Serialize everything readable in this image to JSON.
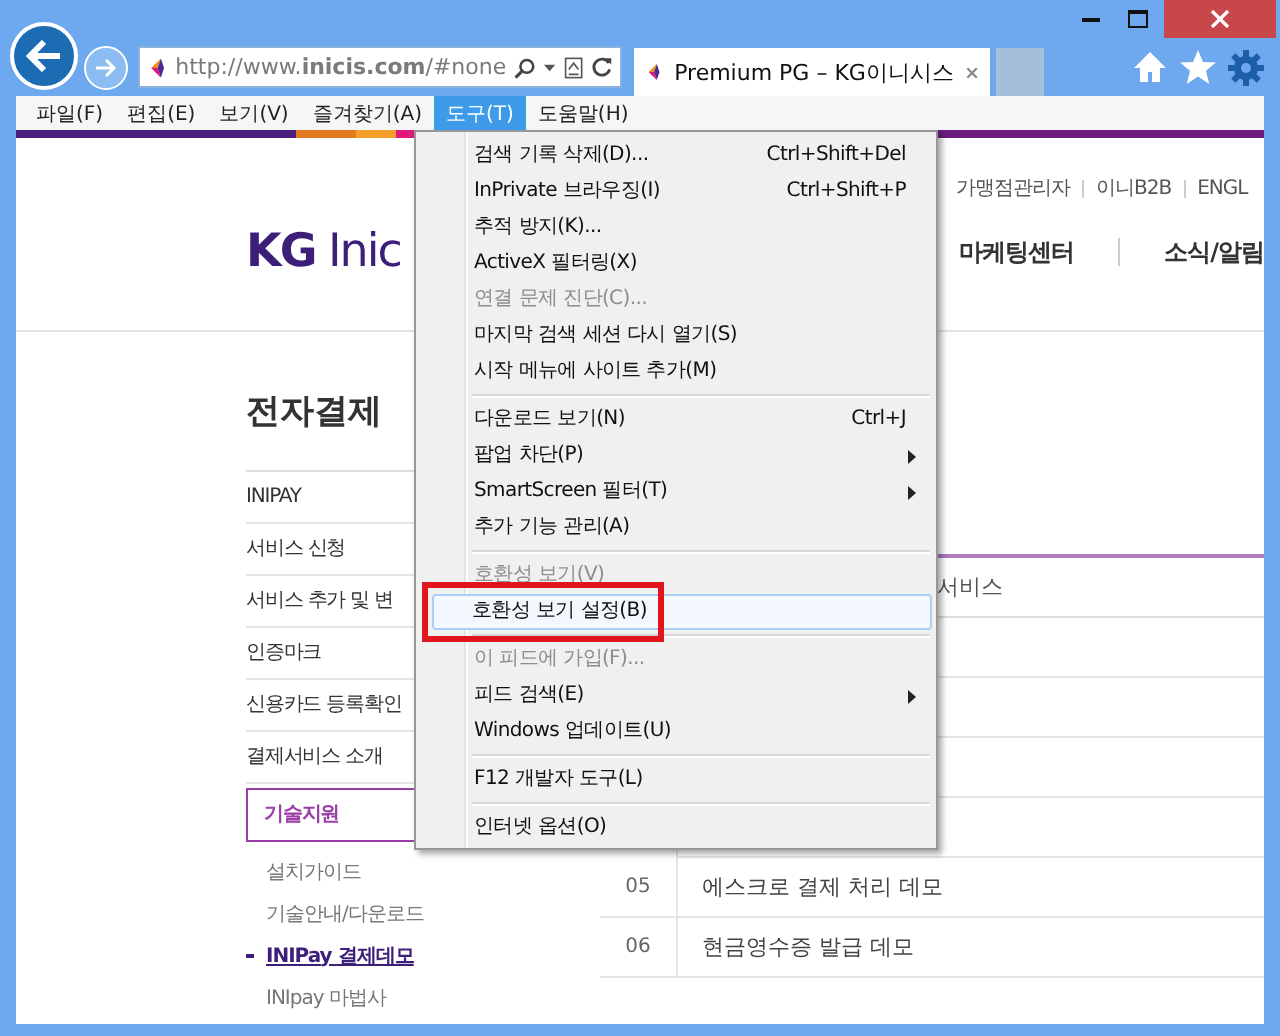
{
  "window": {
    "controls": [
      {
        "kind": "minimize"
      },
      {
        "kind": "maximize"
      },
      {
        "kind": "close"
      }
    ]
  },
  "navigation": {
    "address": "http://www.**inicis.com**/#none",
    "tab_title": "Premium PG – KG이니시스"
  },
  "menu_bar": [
    {
      "label": "파일(F)",
      "selected": false
    },
    {
      "label": "편집(E)",
      "selected": false
    },
    {
      "label": "보기(V)",
      "selected": false
    },
    {
      "label": "즐겨찾기(A)",
      "selected": false
    },
    {
      "label": "도구(T)",
      "selected": true
    },
    {
      "label": "도움말(H)",
      "selected": false
    }
  ],
  "tools_menu": {
    "sections": [
      {
        "items": [
          {
            "label": "검색 기록 삭제(D)...",
            "shortcut": "Ctrl+Shift+Del",
            "disabled": false,
            "submenu": false,
            "selected": false,
            "marked": false
          },
          {
            "label": "InPrivate 브라우징(I)",
            "shortcut": "Ctrl+Shift+P",
            "disabled": false,
            "submenu": false,
            "selected": false,
            "marked": false
          },
          {
            "label": "추적 방지(K)...",
            "disabled": false,
            "submenu": false,
            "selected": false,
            "marked": false
          },
          {
            "label": "ActiveX 필터링(X)",
            "disabled": false,
            "submenu": false,
            "selected": false,
            "marked": false
          },
          {
            "label": "연결 문제 진단(C)...",
            "disabled": true,
            "submenu": false,
            "selected": false,
            "marked": false
          },
          {
            "label": "마지막 검색 세션 다시 열기(S)",
            "disabled": false,
            "submenu": false,
            "selected": false,
            "marked": false
          },
          {
            "label": "시작 메뉴에 사이트 추가(M)",
            "disabled": false,
            "submenu": false,
            "selected": false,
            "marked": false
          }
        ]
      },
      {
        "items": [
          {
            "label": "다운로드 보기(N)",
            "shortcut": "Ctrl+J",
            "disabled": false,
            "submenu": false,
            "selected": false,
            "marked": false
          },
          {
            "label": "팝업 차단(P)",
            "disabled": false,
            "submenu": true,
            "selected": false,
            "marked": false
          },
          {
            "label": "SmartScreen 필터(T)",
            "disabled": false,
            "submenu": true,
            "selected": false,
            "marked": false
          },
          {
            "label": "추가 기능 관리(A)",
            "disabled": false,
            "submenu": false,
            "selected": false,
            "marked": false
          }
        ]
      },
      {
        "items": [
          {
            "label": "호환성 보기(V)",
            "disabled": true,
            "submenu": false,
            "selected": false,
            "marked": false
          },
          {
            "label": "호환성 보기 설정(B)",
            "disabled": false,
            "submenu": false,
            "selected": true,
            "marked": true
          }
        ]
      },
      {
        "items": [
          {
            "label": "이 피드에 가입(F)...",
            "disabled": true,
            "submenu": false,
            "selected": false,
            "marked": false
          },
          {
            "label": "피드 검색(E)",
            "disabled": false,
            "submenu": true,
            "selected": false,
            "marked": false
          },
          {
            "label": "Windows 업데이트(U)",
            "disabled": false,
            "submenu": false,
            "selected": false,
            "marked": false
          }
        ]
      },
      {
        "items": [
          {
            "label": "F12 개발자 도구(L)",
            "disabled": false,
            "submenu": false,
            "selected": false,
            "marked": false
          }
        ]
      },
      {
        "items": [
          {
            "label": "인터넷 옵션(O)",
            "disabled": false,
            "submenu": false,
            "selected": false,
            "marked": false
          }
        ]
      }
    ]
  },
  "page": {
    "top_links": [
      "가맹점관리자",
      "이니B2B",
      "ENGL"
    ],
    "logo": "**KG** Inic",
    "nav": [
      "마케팅센터",
      "소식/알림"
    ],
    "heading": "전자결제",
    "side_nav": [
      {
        "label": "INIPAY",
        "selected": false
      },
      {
        "label": "서비스 신청",
        "selected": false
      },
      {
        "label": "서비스 추가 및 변",
        "selected": false
      },
      {
        "label": "인증마크",
        "selected": false
      },
      {
        "label": "신용카드 등록확인",
        "selected": false
      },
      {
        "label": "결제서비스 소개",
        "selected": false
      },
      {
        "label": "기술지원",
        "selected": true,
        "children": [
          {
            "label": "설치가이드",
            "selected": false
          },
          {
            "label": "기술안내/다운로드",
            "selected": false
          },
          {
            "label": "INIPay 결제데모",
            "selected": true
          },
          {
            "label": "INIpay 마법사",
            "selected": false
          }
        ]
      }
    ],
    "table": {
      "column_header": "서비스",
      "rows": [
        {
          "number": "05",
          "name": "에스크로 결제 처리 데모"
        },
        {
          "number": "06",
          "name": "현금영수증 발급 데모"
        }
      ]
    }
  }
}
